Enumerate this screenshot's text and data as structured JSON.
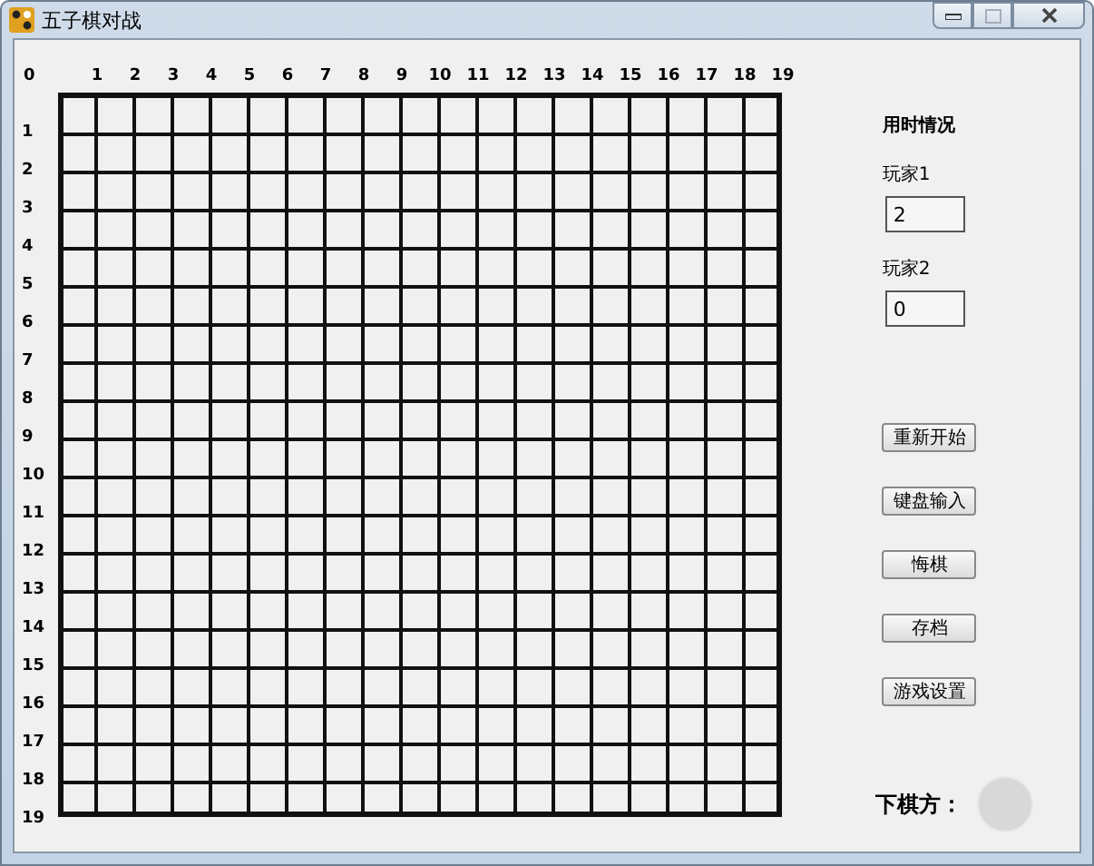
{
  "window": {
    "title": "五子棋对战"
  },
  "board": {
    "corner_label": "0",
    "column_labels": [
      "1",
      "2",
      "3",
      "4",
      "5",
      "6",
      "7",
      "8",
      "9",
      "10",
      "11",
      "12",
      "13",
      "14",
      "15",
      "16",
      "17",
      "18",
      "19"
    ],
    "row_labels": [
      "1",
      "2",
      "3",
      "4",
      "5",
      "6",
      "7",
      "8",
      "9",
      "10",
      "11",
      "12",
      "13",
      "14",
      "15",
      "16",
      "17",
      "18",
      "19"
    ]
  },
  "timer": {
    "heading": "用时情况",
    "players": [
      {
        "label": "玩家1",
        "value": "2"
      },
      {
        "label": "玩家2",
        "value": "0"
      }
    ]
  },
  "buttons": [
    "重新开始",
    "键盘输入",
    "悔棋",
    "存档",
    "游戏设置"
  ],
  "turn": {
    "label": "下棋方："
  }
}
